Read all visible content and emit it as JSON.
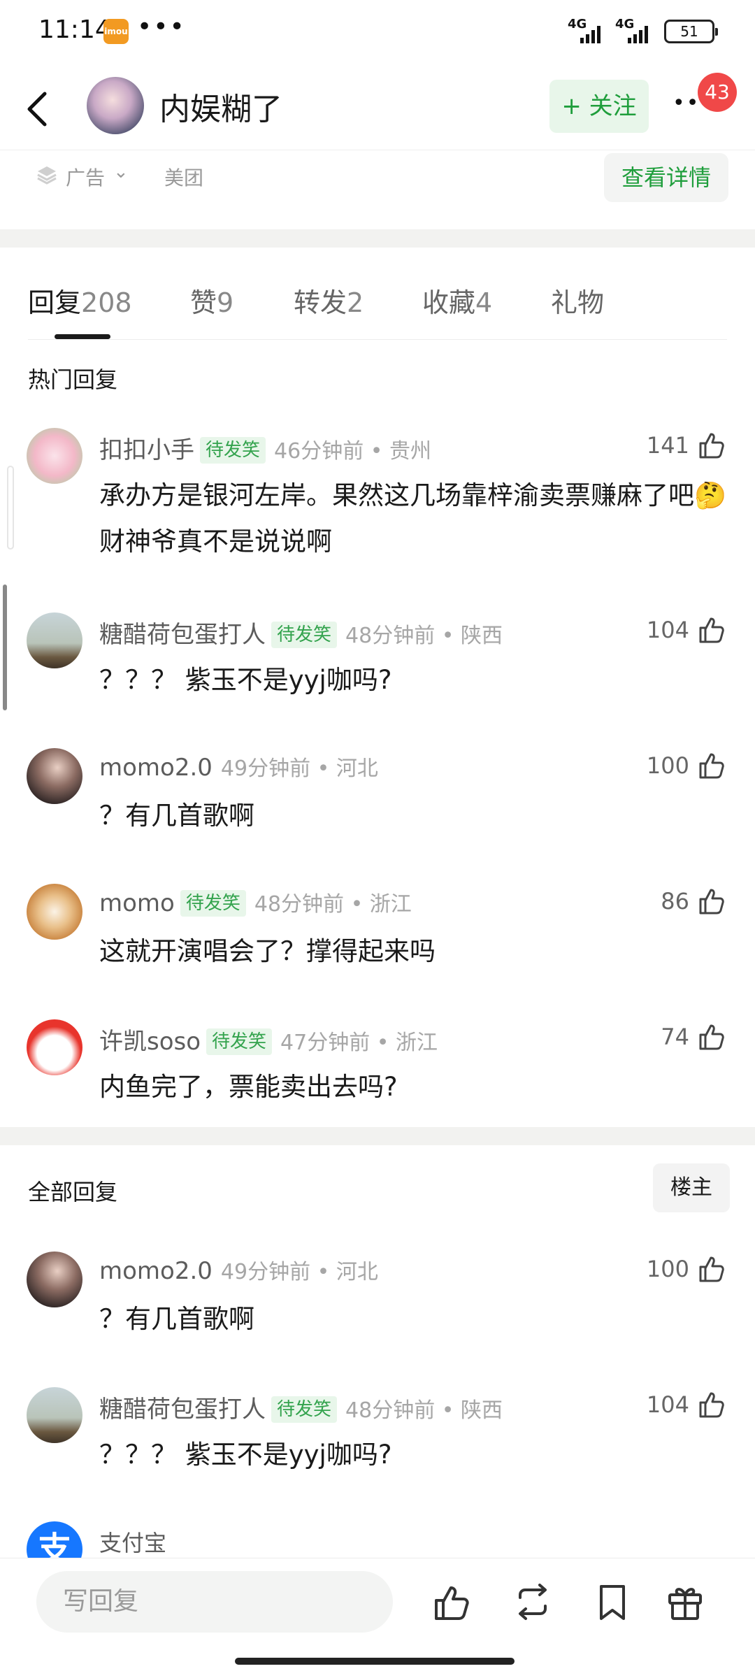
{
  "status_bar": {
    "time": "11:14",
    "app_icon_text": "imou",
    "dots": "•••",
    "signal1": "4G",
    "signal2": "4G",
    "battery": "51"
  },
  "header": {
    "title": "内娱糊了",
    "follow_label": "+ 关注",
    "more_label": "••",
    "badge_count": "43"
  },
  "ad": {
    "label": "广告",
    "brand": "美团",
    "detail_label": "查看详情"
  },
  "tabs": [
    {
      "label": "回复",
      "count": "208"
    },
    {
      "label": "赞",
      "count": "9"
    },
    {
      "label": "转发",
      "count": "2"
    },
    {
      "label": "收藏",
      "count": "4"
    },
    {
      "label": "礼物",
      "count": ""
    }
  ],
  "hot_title": "热门回复",
  "hot_comments": [
    {
      "name": "扣扣小手",
      "tag": "待发笑",
      "meta": "46分钟前 • 贵州",
      "likes": "141",
      "text": "承办方是银河左岸。果然这几场靠梓渝卖票赚麻了吧🤔 财神爷真不是说说啊"
    },
    {
      "name": "糖醋荷包蛋打人",
      "tag": "待发笑",
      "meta": "48分钟前 • 陕西",
      "likes": "104",
      "text": "？？？ 紫玉不是yyj咖吗?"
    },
    {
      "name": "momo2.0",
      "tag": "",
      "meta": "49分钟前 • 河北",
      "likes": "100",
      "text": "？有几首歌啊"
    },
    {
      "name": "momo",
      "tag": "待发笑",
      "meta": "48分钟前 • 浙江",
      "likes": "86",
      "text": "这就开演唱会了？撑得起来吗"
    },
    {
      "name": "许凯soso",
      "tag": "待发笑",
      "meta": "47分钟前 • 浙江",
      "likes": "74",
      "text": "内鱼完了，票能卖出去吗?"
    }
  ],
  "all_title": "全部回复",
  "owner_label": "楼主",
  "all_comments": [
    {
      "name": "momo2.0",
      "tag": "",
      "meta": "49分钟前 • 河北",
      "likes": "100",
      "text": "？有几首歌啊"
    },
    {
      "name": "糖醋荷包蛋打人",
      "tag": "待发笑",
      "meta": "48分钟前 • 陕西",
      "likes": "104",
      "text": "？？？ 紫玉不是yyj咖吗?"
    }
  ],
  "partial_comment": {
    "name": "支付宝",
    "avatar_char": "支"
  },
  "bottom": {
    "reply_placeholder": "写回复",
    "icons": [
      "like-icon",
      "repost-icon",
      "bookmark-icon",
      "gift-icon"
    ]
  },
  "colors": {
    "accent_green": "#1f9e3c",
    "tag_bg": "#e8f6ea",
    "badge_red": "#f04848"
  }
}
